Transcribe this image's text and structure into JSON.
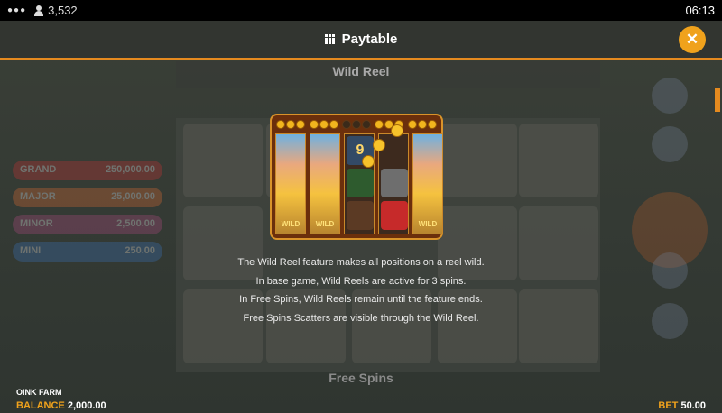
{
  "status_bar": {
    "player_count": "3,532",
    "clock": "06:13"
  },
  "header": {
    "title": "Paytable",
    "close_symbol": "✕"
  },
  "section": {
    "title": "Wild Reel",
    "next_section_title": "Free Spins"
  },
  "illustration": {
    "wild_label": "WILD",
    "number_symbol": "9"
  },
  "description": [
    "The Wild Reel feature makes all positions on a reel wild.",
    "In base game, Wild Reels are active for 3 spins.",
    "In Free Spins, Wild Reels remain until the feature ends.",
    "Free Spins Scatters are visible through the Wild Reel."
  ],
  "background_jackpots": [
    {
      "label": "GRAND",
      "value": "250,000.00"
    },
    {
      "label": "MAJOR",
      "value": "25,000.00"
    },
    {
      "label": "MINOR",
      "value": "2,500.00"
    },
    {
      "label": "MINI",
      "value": "250.00"
    }
  ],
  "footer": {
    "game_name": "OINK FARM",
    "balance_label": "BALANCE",
    "balance_value": "2,000.00",
    "bet_label": "BET",
    "bet_value": "50.00"
  },
  "colors": {
    "accent": "#f0a21c",
    "header_rule": "#e58a1f"
  }
}
